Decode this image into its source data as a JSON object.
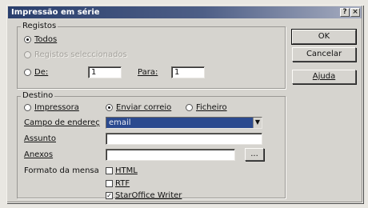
{
  "window": {
    "title": "Impressão em série",
    "title_buttons": [
      "help-icon",
      "close-icon"
    ]
  },
  "registos": {
    "legend": "Registos",
    "options": [
      {
        "label": "Todos",
        "checked": true,
        "enabled": true
      },
      {
        "label": "Registos seleccionados",
        "checked": false,
        "enabled": false
      },
      {
        "label": "De:",
        "checked": false,
        "enabled": true
      }
    ],
    "de_value": "1",
    "para_label": "Para:",
    "para_value": "1"
  },
  "destino": {
    "legend": "Destino",
    "options": [
      {
        "label": "Impressora",
        "checked": false
      },
      {
        "label": "Enviar correio",
        "checked": true
      },
      {
        "label": "Ficheiro",
        "checked": false
      }
    ],
    "campo_label": "Campo de endereç",
    "campo_value": "email",
    "assunto_label": "Assunto",
    "assunto_value": "",
    "anexos_label": "Anexos",
    "anexos_value": "",
    "anexos_button": "...",
    "formato_label": "Formato da mensa",
    "formats": [
      {
        "label": "HTML",
        "checked": false
      },
      {
        "label": "RTF",
        "checked": false
      },
      {
        "label": "StarOffice Writer",
        "checked": true
      }
    ]
  },
  "buttons": {
    "ok": "OK",
    "cancel": "Cancelar",
    "help": "Ajuda"
  },
  "colors": {
    "titlebar": "#2a3f6d",
    "selection": "#2b4a8f",
    "dialog_bg": "#d6d4cf"
  }
}
